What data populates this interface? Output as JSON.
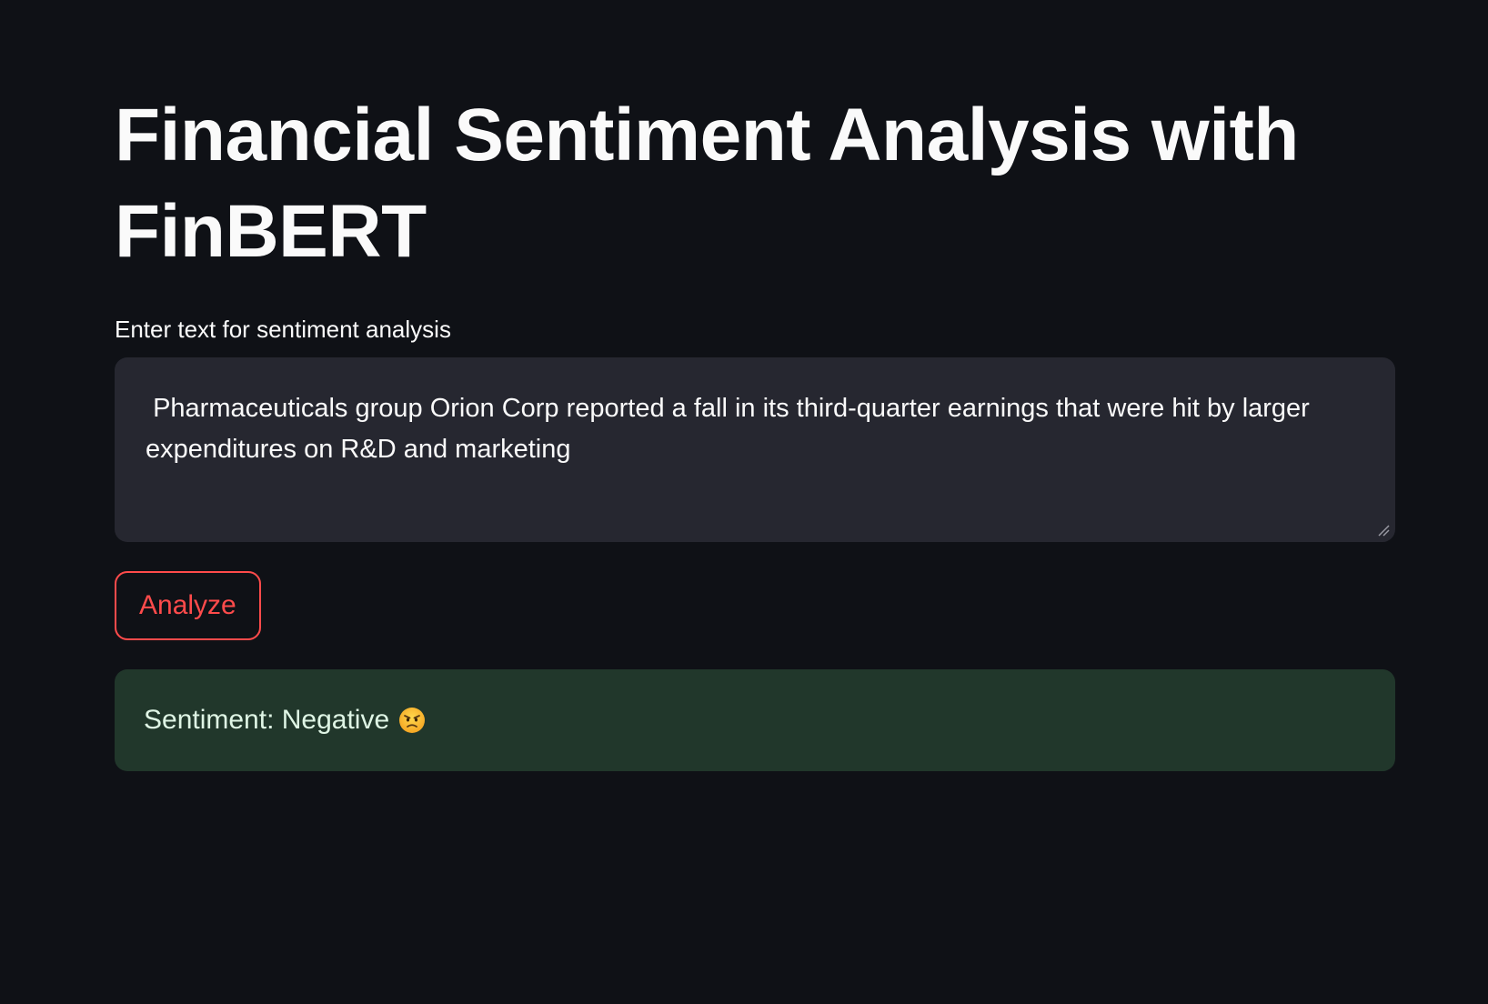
{
  "app": {
    "title": "Financial Sentiment Analysis with FinBERT"
  },
  "input": {
    "label": "Enter text for sentiment analysis",
    "value": " Pharmaceuticals group Orion Corp reported a fall in its third-quarter earnings that were hit by larger expenditures on R&D and marketing"
  },
  "actions": {
    "analyze_label": "Analyze"
  },
  "result": {
    "text": "Sentiment: Negative",
    "emoji_icon": "angry-face-icon"
  },
  "colors": {
    "background": "#0f1116",
    "accent": "#ff4b4b",
    "input_bg": "#262730",
    "success_bg": "#21372b"
  }
}
